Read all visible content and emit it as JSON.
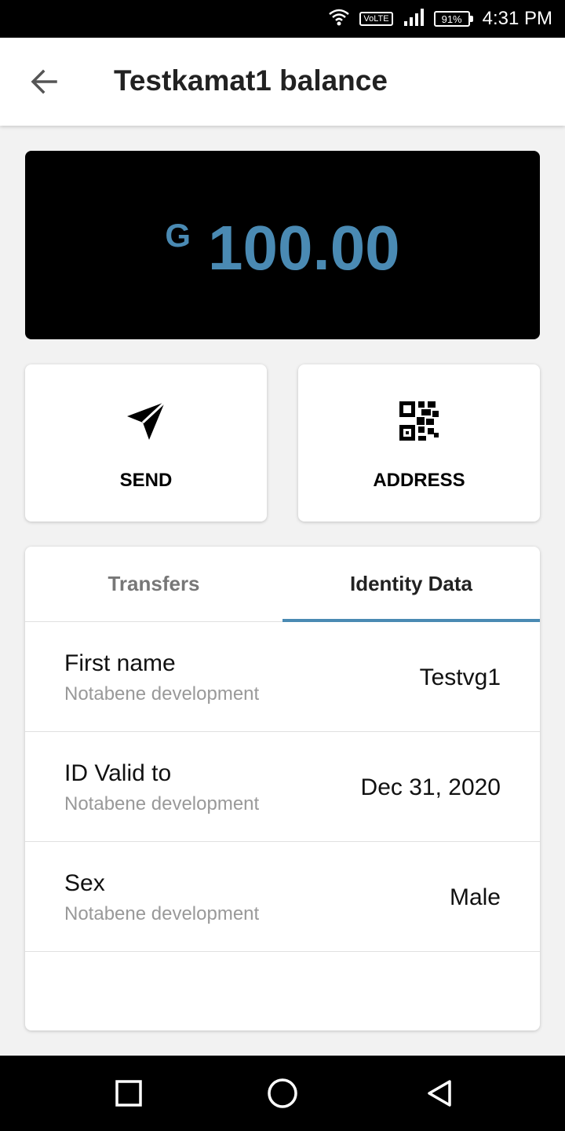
{
  "status_bar": {
    "network_label": "VoLTE",
    "battery_percent": "91%",
    "time": "4:31 PM"
  },
  "app_bar": {
    "title": "Testkamat1 balance"
  },
  "balance": {
    "currency_symbol": "G",
    "amount": "100.00",
    "accent_color": "#4a8ab3"
  },
  "actions": [
    {
      "label": "SEND",
      "icon": "send-icon"
    },
    {
      "label": "ADDRESS",
      "icon": "qr-code-icon"
    }
  ],
  "tabs": [
    {
      "label": "Transfers",
      "active": false
    },
    {
      "label": "Identity Data",
      "active": true
    }
  ],
  "identity_rows": [
    {
      "label": "First name",
      "source": "Notabene development",
      "value": "Testvg1"
    },
    {
      "label": "ID Valid to",
      "source": "Notabene development",
      "value": "Dec 31, 2020"
    },
    {
      "label": "Sex",
      "source": "Notabene development",
      "value": "Male"
    }
  ]
}
